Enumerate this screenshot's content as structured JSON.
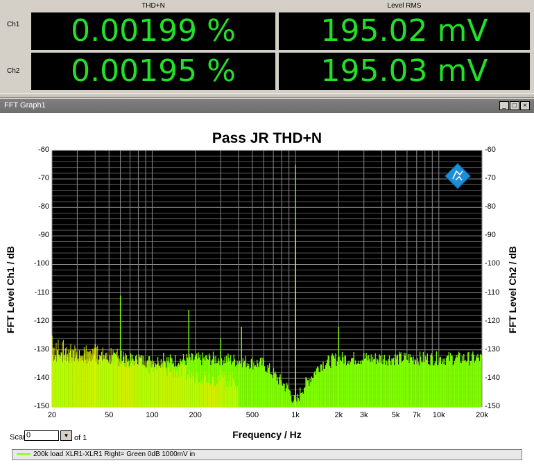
{
  "meters": {
    "col1_header": "THD+N",
    "col2_header": "Level RMS",
    "ch1_label": "Ch1",
    "ch2_label": "Ch2",
    "ch1_thd": "0.00199 %",
    "ch1_level": "195.02 mV",
    "ch2_thd": "0.00195 %",
    "ch2_level": "195.03 mV"
  },
  "window": {
    "title": "FFT Graph1",
    "btn_min": "_",
    "btn_max": "□",
    "btn_close": "×"
  },
  "scan": {
    "label": "Scan",
    "value": "0",
    "of": "of 1"
  },
  "legend": {
    "text": "200k load XLR1-XLR1 Right= Green 0dB 1000mV in"
  },
  "colors": {
    "display_bg": "#000000",
    "display_text": "#22e02a",
    "trace_green": "#7fff00",
    "trace_yellow": "#e8f000"
  },
  "chart_data": {
    "type": "line",
    "title": "Pass JR THD+N",
    "xlabel": "Frequency / Hz",
    "ylabel_left": "FFT Level Ch1 / dB",
    "ylabel_right": "FFT Level Ch2 / dB",
    "xscale": "log",
    "xlim": [
      20,
      20000
    ],
    "ylim": [
      -150,
      -60
    ],
    "grid": true,
    "x_ticks": [
      "20",
      "50",
      "100",
      "200",
      "500",
      "1k",
      "2k",
      "3k",
      "5k",
      "7k",
      "10k",
      "20k"
    ],
    "y_ticks": [
      "-60",
      "-70",
      "-80",
      "-90",
      "-100",
      "-110",
      "-120",
      "-130",
      "-140",
      "-150"
    ],
    "series": [
      {
        "color": "#7fff00",
        "peaks": [
          [
            1000,
            -65
          ],
          [
            2000,
            -122
          ],
          [
            3000,
            -131
          ],
          [
            5000,
            -133
          ],
          [
            60,
            -111
          ],
          [
            120,
            -131
          ],
          [
            180,
            -116
          ],
          [
            300,
            -126
          ],
          [
            420,
            -122
          ]
        ],
        "floor": [
          [
            20,
            -133
          ],
          [
            100,
            -135
          ],
          [
            300,
            -134
          ],
          [
            600,
            -136
          ],
          [
            900,
            -145
          ],
          [
            1000,
            -150
          ],
          [
            1100,
            -145
          ],
          [
            1500,
            -136
          ],
          [
            2000,
            -134
          ],
          [
            5000,
            -134
          ],
          [
            20000,
            -134
          ]
        ]
      },
      {
        "color": "#e8f000",
        "peaks": [
          [
            1000,
            -88
          ],
          [
            20,
            -125
          ],
          [
            40,
            -128
          ]
        ],
        "floor": [
          [
            20,
            -130
          ],
          [
            50,
            -133
          ],
          [
            100,
            -137
          ],
          [
            200,
            -140
          ],
          [
            400,
            -142
          ]
        ]
      }
    ]
  }
}
